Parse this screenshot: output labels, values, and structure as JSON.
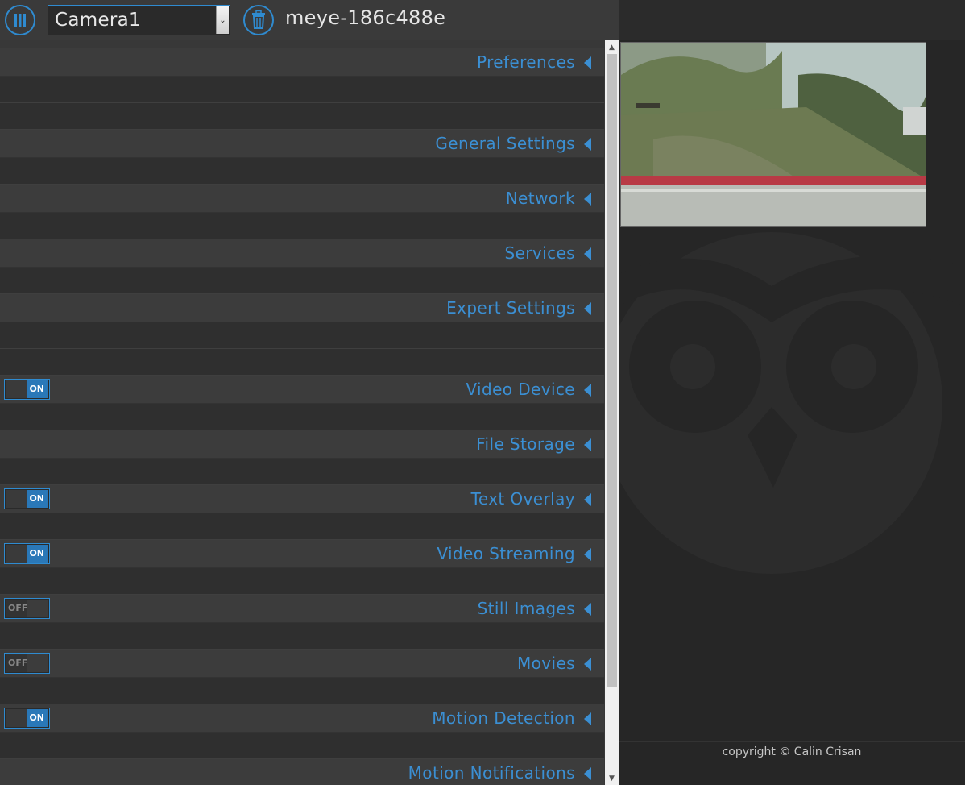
{
  "header": {
    "camera_select": "Camera1",
    "hostname": "meye-186c488e"
  },
  "settings": {
    "rows": [
      {
        "label": "Preferences"
      },
      {
        "label": "General Settings"
      },
      {
        "label": "Network"
      },
      {
        "label": "Services"
      },
      {
        "label": "Expert Settings"
      },
      {
        "label": "Video Device",
        "toggle": "ON"
      },
      {
        "label": "File Storage"
      },
      {
        "label": "Text Overlay",
        "toggle": "ON"
      },
      {
        "label": "Video Streaming",
        "toggle": "ON"
      },
      {
        "label": "Still Images",
        "toggle": "OFF"
      },
      {
        "label": "Movies",
        "toggle": "OFF"
      },
      {
        "label": "Motion Detection",
        "toggle": "ON"
      },
      {
        "label": "Motion Notifications"
      }
    ]
  },
  "footer": {
    "copyright": "copyright © Calin Crisan"
  },
  "colors": {
    "accent": "#2f8bd0",
    "label": "#3b8fd3",
    "panel": "#383838"
  }
}
